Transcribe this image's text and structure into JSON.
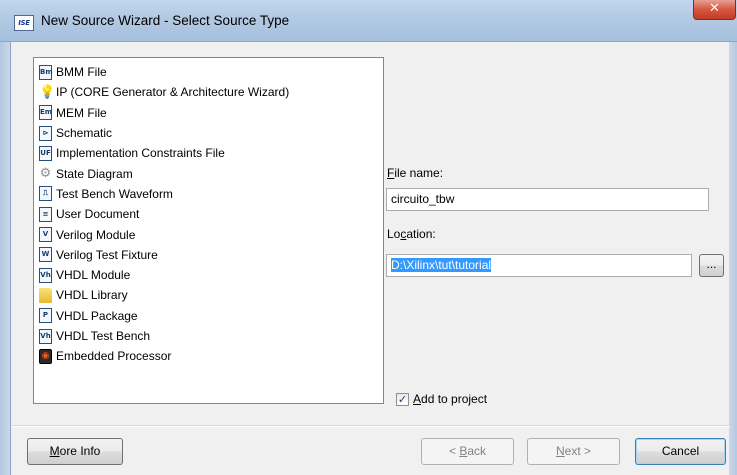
{
  "window": {
    "app_icon_text": "ISE",
    "title": "New Source Wizard - Select Source Type",
    "close_symbol": "✕"
  },
  "source_types": [
    {
      "label": "BMM File",
      "icon": "bmm-file-icon",
      "glyph": "Bm"
    },
    {
      "label": "IP (CORE Generator & Architecture Wizard)",
      "icon": "ip-core-bulb-icon",
      "glyph": "💡"
    },
    {
      "label": "MEM File",
      "icon": "mem-file-icon",
      "glyph": "Em"
    },
    {
      "label": "Schematic",
      "icon": "schematic-icon",
      "glyph": "⊳"
    },
    {
      "label": "Implementation Constraints File",
      "icon": "constraints-file-icon",
      "glyph": "UF"
    },
    {
      "label": "State Diagram",
      "icon": "state-diagram-gears-icon",
      "glyph": "⚙"
    },
    {
      "label": "Test Bench Waveform",
      "icon": "waveform-icon",
      "glyph": "⎍"
    },
    {
      "label": "User Document",
      "icon": "user-document-icon",
      "glyph": "≡"
    },
    {
      "label": "Verilog Module",
      "icon": "verilog-module-icon",
      "glyph": "V"
    },
    {
      "label": "Verilog Test Fixture",
      "icon": "verilog-test-fixture-icon",
      "glyph": "W"
    },
    {
      "label": "VHDL Module",
      "icon": "vhdl-module-icon",
      "glyph": "Vh"
    },
    {
      "label": "VHDL Library",
      "icon": "vhdl-library-folder-icon",
      "glyph": ""
    },
    {
      "label": "VHDL Package",
      "icon": "vhdl-package-icon",
      "glyph": "P"
    },
    {
      "label": "VHDL Test Bench",
      "icon": "vhdl-test-bench-icon",
      "glyph": "Vh"
    },
    {
      "label": "Embedded Processor",
      "icon": "embedded-processor-icon",
      "glyph": "◉"
    }
  ],
  "file_name": {
    "label_accel": "F",
    "label_rest": "ile name:",
    "value": "circuito_tbw"
  },
  "location": {
    "label_pre": "Lo",
    "label_accel": "c",
    "label_rest": "ation:",
    "value": "D:\\Xilinx\\tut\\tutorial",
    "browse_label": "..."
  },
  "add_to_project": {
    "checked": true,
    "check_mark": "✓",
    "label_accel": "A",
    "label_rest": "dd to project"
  },
  "buttons": {
    "more_info_accel": "M",
    "more_info_rest": "ore Info",
    "back_pre": "< ",
    "back_accel": "B",
    "back_rest": "ack",
    "next_accel": "N",
    "next_rest": "ext >",
    "cancel": "Cancel"
  }
}
